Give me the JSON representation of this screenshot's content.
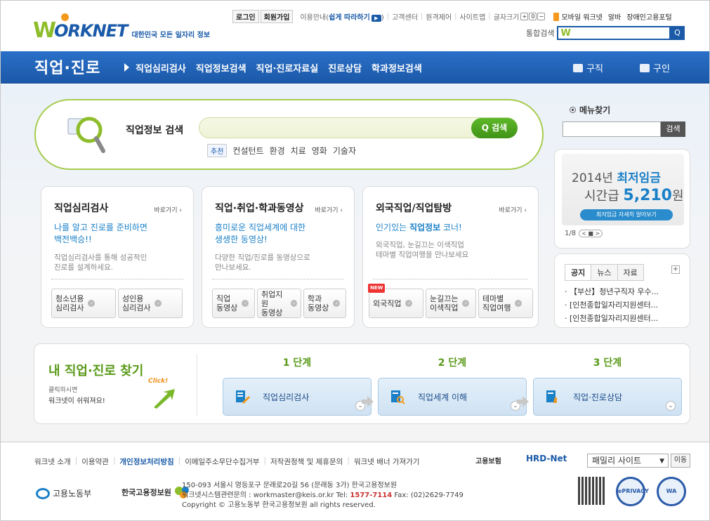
{
  "header": {
    "logo_w": "W",
    "logo_rest": "ORKNET",
    "tagline": "대한민국 모든 일자리 정보",
    "login": "로그인",
    "join": "회원가입",
    "guide_pre": "이용안내(",
    "guide_hl": "쉽게 따라하기",
    "guide_post": ")",
    "util_links": [
      "고객센터",
      "원격제어",
      "사이트맵"
    ],
    "font_size": "글자크기",
    "font_plus": "+",
    "font_reset": "0",
    "font_minus": "−",
    "mobile": "모바일 워크넷",
    "alba": "알바",
    "disabled": "장애인고용포털",
    "search_label": "통합검색",
    "search_mark": "W",
    "search_button": "Q"
  },
  "nav": {
    "title": "직업·진로",
    "items": [
      "직업심리검사",
      "직업정보검색",
      "직업·진로자료실",
      "진로상담",
      "학과정보검색"
    ],
    "job_seek": "구직",
    "recruit": "구인"
  },
  "search": {
    "label": "직업정보 검색",
    "button": "Q 검색",
    "rec": "추천",
    "tags": [
      "컨설턴트",
      "환경",
      "치료",
      "영화",
      "기술자"
    ]
  },
  "menu_find": {
    "title": "메뉴찾기",
    "button": "검색"
  },
  "wage": {
    "year": "2014년 ",
    "title": "최저임금",
    "hourly": "시간급 ",
    "amount": "5,210",
    "won": "원",
    "button": "최저임금 자세히 알아보기",
    "page": "1/8",
    "prev": "<",
    "stop": "■",
    "next": ">"
  },
  "cards": [
    {
      "title": "직업심리검사",
      "go": "바로가기 ›",
      "blue1": "나를 알고 진로를 준비하면",
      "blue2": "백전백승!!",
      "gray1": "직업심리검사를 통해 성공적인",
      "gray2": "진로를 설계하세요.",
      "btns": [
        [
          "청소년용",
          "심리검사"
        ],
        [
          "성인용",
          "심리검사"
        ]
      ]
    },
    {
      "title": "직업·취업·학과동영상",
      "go": "바로가기 ›",
      "blue1": "흥미로운 직업세계에 대한",
      "blue2": "생생한 동영상!",
      "gray1": "다양한 직업/진로를 동영상으로",
      "gray2": "만나보세요.",
      "btns": [
        [
          "직업",
          "동영상"
        ],
        [
          "취업지원",
          "동영상"
        ],
        [
          "학과",
          "동영상"
        ]
      ]
    },
    {
      "title": "외국직업/직업탐방",
      "go": "바로가기 ›",
      "blue1": "인기있는 ",
      "blue1b": "직업정보",
      "blue1c": " 코너!",
      "gray1": "외국직업, 눈길끄는 이색직업",
      "gray2": "테마별 직업여행을 만나보세요",
      "new": "NEW",
      "btns": [
        [
          "외국직업",
          ""
        ],
        [
          "눈길끄는",
          "이색직업"
        ],
        [
          "테마별",
          "직업여행"
        ]
      ]
    }
  ],
  "notice": {
    "tabs": [
      "공지",
      "뉴스",
      "자료"
    ],
    "plus": "+",
    "items": [
      "· 【부산】청년구직자 우수...",
      "· [인천종합일자리지원센터...",
      "· [인천종합일자리지원센터..."
    ]
  },
  "steps": {
    "title": "내 직업·진로 찾기",
    "sub1": "클릭하시면",
    "sub2": "워크넷이 쉬워져요!",
    "click": "Click!",
    "labels": [
      "1 단계",
      "2 단계",
      "3 단계"
    ],
    "boxes": [
      "직업심리검사",
      "직업세계 이해",
      "직업·진로상담"
    ]
  },
  "footer": {
    "links": [
      "워크넷 소개",
      "이용약관",
      "개인정보처리방침",
      "이메일주소무단수집거부",
      "저작권정책 및 제휴문의",
      "워크넷 배너 가져가기"
    ],
    "partner1": "고용보험",
    "partner2": "HRD-Net",
    "family": "패밀리 사이트",
    "move": "이동",
    "org1": "고용노동부",
    "org2": "한국고용정보원",
    "addr1": "150-093 서울시 영등포구 문래로20길 56 (문래동 3가) 한국고용정보원",
    "addr2_pre": "워크넷시스템관련문의 : workmaster@keis.or.kr  Tel: ",
    "addr2_tel": "1577-7114",
    "addr2_post": "  Fax: (02)2629-7749",
    "copy": "Copyright ©  고용노동부  한국고용정보원  all rights reserved.",
    "seal1": "ePRIVACY",
    "seal2": "WA"
  },
  "colors": {
    "brand_blue": "#1a5aa8",
    "brand_green": "#8dbd2a",
    "accent_orange": "#f39a1e",
    "link_blue": "#1a80c8"
  }
}
